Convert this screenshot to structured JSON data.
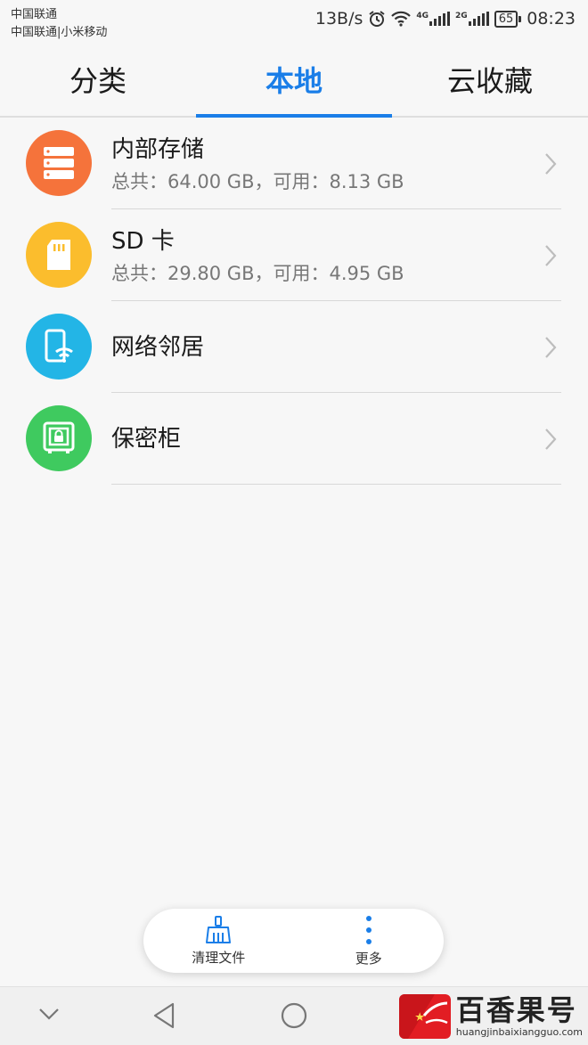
{
  "status_bar": {
    "carrier1": "中国联通",
    "carrier2": "中国联通|小米移动",
    "speed": "13B/s",
    "net1": "4G",
    "net2": "2G",
    "battery": "65",
    "time": "08:23"
  },
  "tabs": [
    {
      "label": "分类",
      "active": false
    },
    {
      "label": "本地",
      "active": true
    },
    {
      "label": "云收藏",
      "active": false
    }
  ],
  "items": [
    {
      "title": "内部存储",
      "subtitle": "总共：64.00 GB，可用：8.13 GB",
      "icon": "storage-icon",
      "color": "#f5733b"
    },
    {
      "title": "SD 卡",
      "subtitle": "总共：29.80 GB，可用：4.95 GB",
      "icon": "sd-card-icon",
      "color": "#fbbd2d"
    },
    {
      "title": "网络邻居",
      "subtitle": "",
      "icon": "network-neighbor-icon",
      "color": "#23b5e6"
    },
    {
      "title": "保密柜",
      "subtitle": "",
      "icon": "safe-icon",
      "color": "#3fca5f"
    }
  ],
  "actions": {
    "clean_label": "清理文件",
    "more_label": "更多"
  },
  "watermark": {
    "title": "百香果号",
    "subtitle": "huangjinbaixiangguo.com"
  },
  "colors": {
    "accent": "#1a7ee8"
  }
}
